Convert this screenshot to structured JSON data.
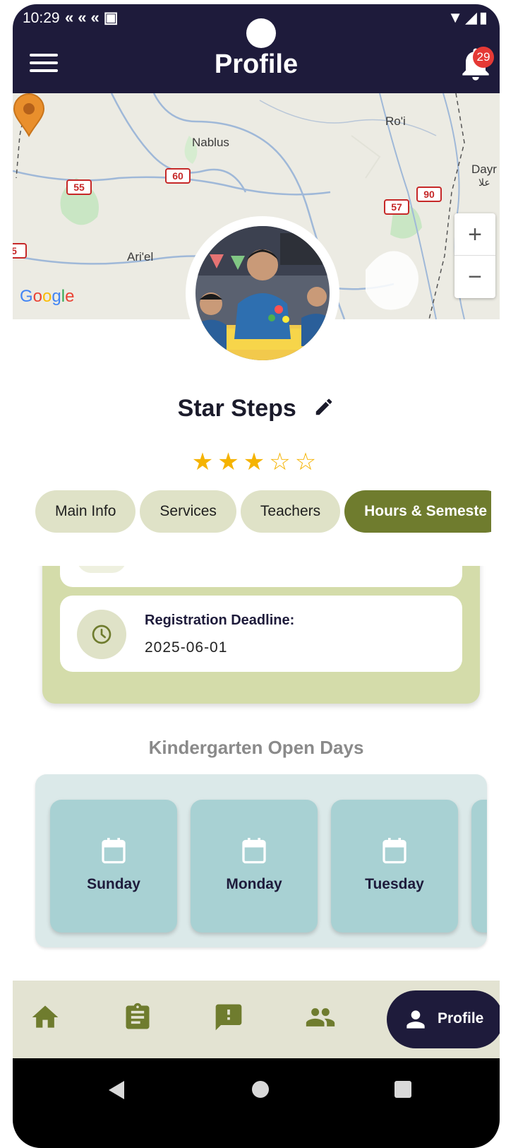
{
  "status_bar": {
    "time": "10:29"
  },
  "app_bar": {
    "title": "Profile",
    "notification_count": "29"
  },
  "map": {
    "labels": {
      "nablus": "Nablus",
      "roi": "Ro'i",
      "ariel": "Ari'el",
      "dayr": "Dayr",
      "dayr_ar": "علا"
    },
    "road_badges": {
      "r55": "55",
      "r60": "60",
      "r57": "57",
      "r90": "90",
      "r5": "5"
    },
    "zoom_in": "+",
    "zoom_out": "−",
    "attribution": "Google"
  },
  "profile": {
    "name": "Star Steps",
    "rating": 3,
    "rating_max": 5
  },
  "tabs": [
    {
      "label": "Main Info",
      "active": false
    },
    {
      "label": "Services",
      "active": false
    },
    {
      "label": "Teachers",
      "active": false
    },
    {
      "label": "Hours & Semeste",
      "active": true
    }
  ],
  "hours": {
    "registration_label": "Registration Deadline:",
    "registration_value": "2025-06-01"
  },
  "open_days": {
    "title": "Kindergarten Open Days",
    "days": [
      "Sunday",
      "Monday",
      "Tuesday"
    ]
  },
  "bottom_nav": {
    "items": [
      "home-icon",
      "clipboard-icon",
      "feedback-icon",
      "people-icon"
    ],
    "active_label": "Profile"
  },
  "colors": {
    "dark": "#1e1b3b",
    "olive": "#6f7c2e",
    "olive_light": "#dfe2c7",
    "teal": "#a8d1d3",
    "star": "#f5b301"
  }
}
